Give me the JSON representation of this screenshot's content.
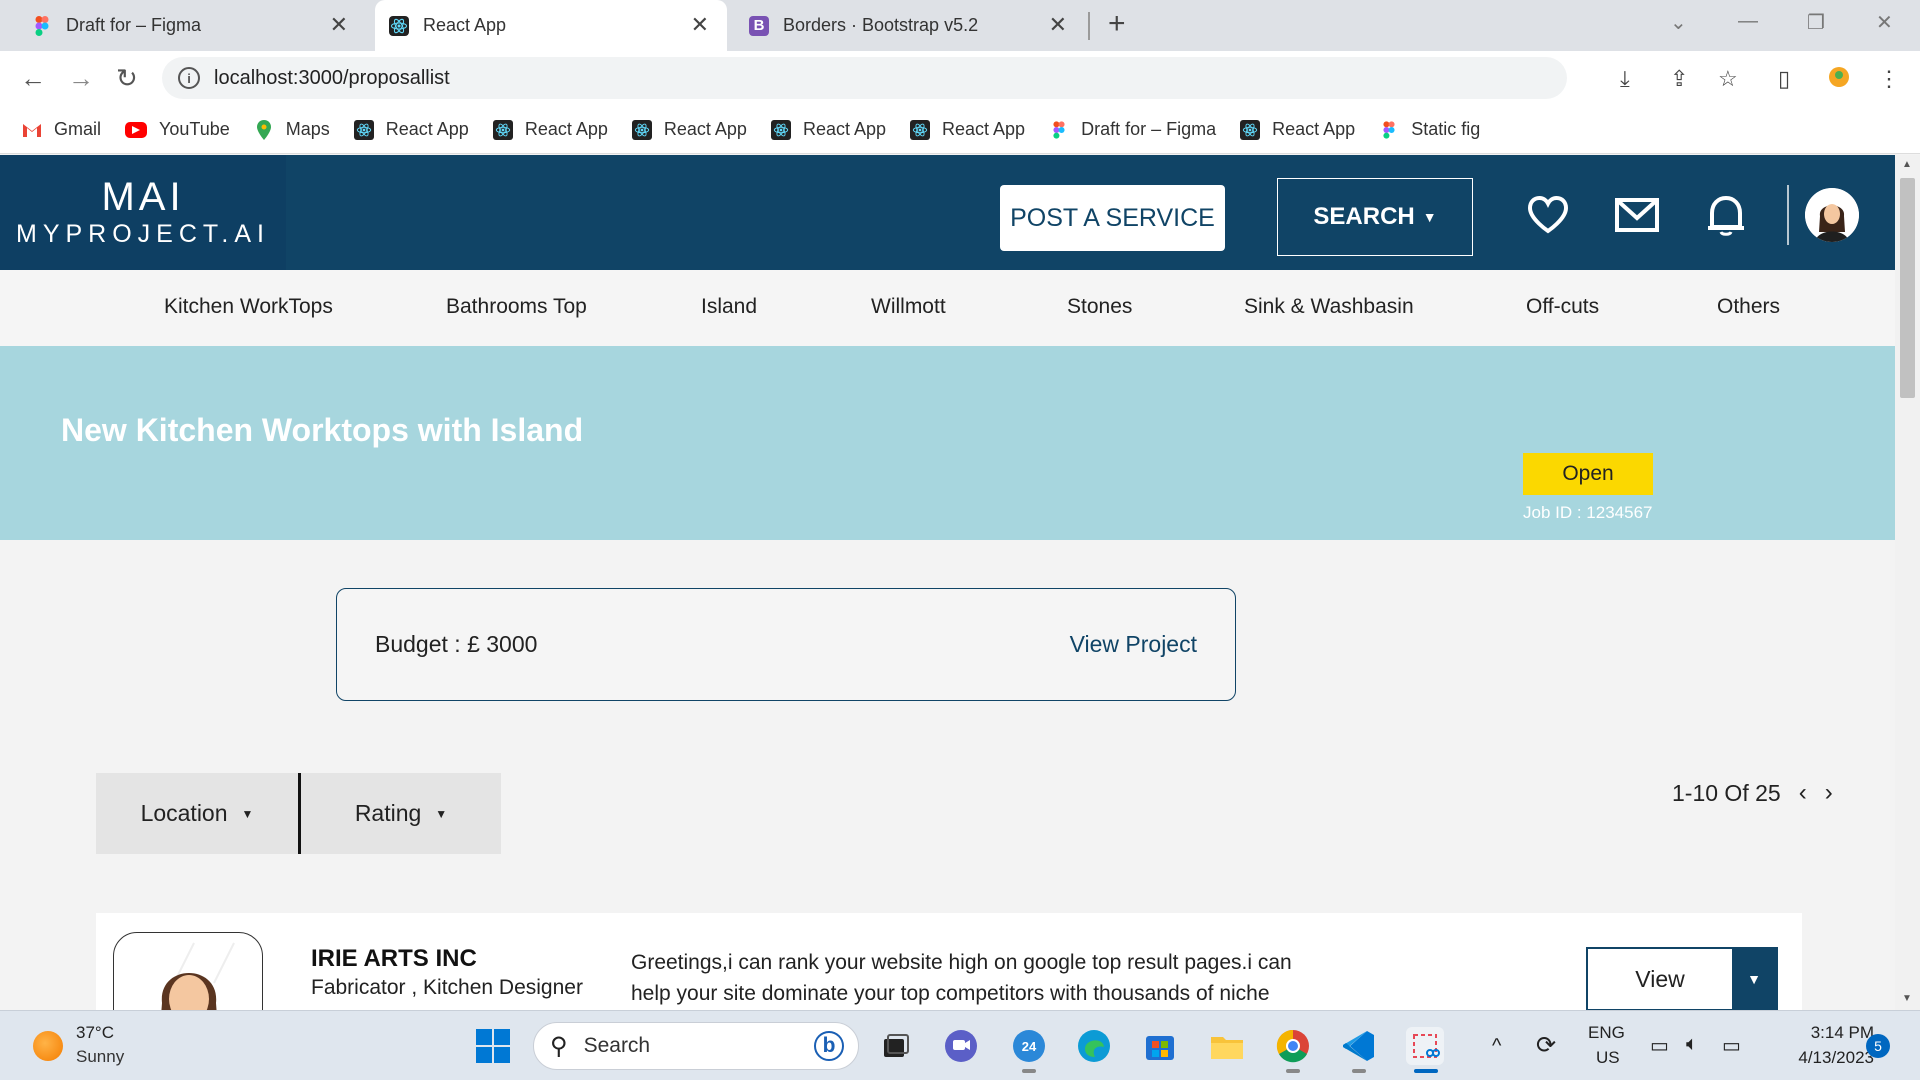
{
  "browser": {
    "tabs": [
      {
        "title": "Draft for – Figma",
        "icon": "figma-icon",
        "active": false
      },
      {
        "title": "React App",
        "icon": "react-icon",
        "active": true
      },
      {
        "title": "Borders · Bootstrap v5.2",
        "icon": "bootstrap-icon",
        "active": false
      }
    ],
    "url": "localhost:3000/proposallist",
    "bookmarks": [
      {
        "label": "Gmail",
        "icon": "gmail-icon"
      },
      {
        "label": "YouTube",
        "icon": "youtube-icon"
      },
      {
        "label": "Maps",
        "icon": "maps-icon"
      },
      {
        "label": "React App",
        "icon": "react-icon"
      },
      {
        "label": "React App",
        "icon": "react-icon"
      },
      {
        "label": "React App",
        "icon": "react-icon"
      },
      {
        "label": "React App",
        "icon": "react-icon"
      },
      {
        "label": "React App",
        "icon": "react-icon"
      },
      {
        "label": "Draft for – Figma",
        "icon": "figma-icon"
      },
      {
        "label": "React App",
        "icon": "react-icon"
      },
      {
        "label": "Static fig",
        "icon": "figma-icon"
      }
    ]
  },
  "header": {
    "logo_mark": "MAI",
    "logo_text": "MYPROJECT.AI",
    "post_service_label": "POST A SERVICE",
    "search_label": "SEARCH"
  },
  "categories": [
    "Kitchen WorkTops",
    "Bathrooms Top",
    "Island",
    "Willmott",
    "Stones",
    "Sink & Washbasin",
    "Off-cuts",
    "Others"
  ],
  "banner": {
    "title": "New Kitchen Worktops with Island",
    "status": "Open",
    "job_id": "Job ID : 1234567"
  },
  "budget": {
    "label": "Budget : £ 3000",
    "view_project": "View Project"
  },
  "filters": {
    "location": "Location",
    "rating": "Rating"
  },
  "pagination": {
    "text": "1-10 Of 25"
  },
  "proposal": {
    "name": "IRIE ARTS INC",
    "role": "Fabricator , Kitchen Designer",
    "description": "Greetings,i can rank your website high on google top result pages.i can help your site dominate your top competitors with thousands of niche",
    "view_label": "View"
  },
  "taskbar": {
    "temperature": "37°C",
    "condition": "Sunny",
    "search_placeholder": "Search",
    "lang_top": "ENG",
    "lang_bottom": "US",
    "time": "3:14 PM",
    "date": "4/13/2023",
    "notifications": "5",
    "teams_badge": "24"
  },
  "colors": {
    "brand_navy": "#104466",
    "banner_bg": "#a7d6de",
    "status_yellow": "#fbd800"
  }
}
